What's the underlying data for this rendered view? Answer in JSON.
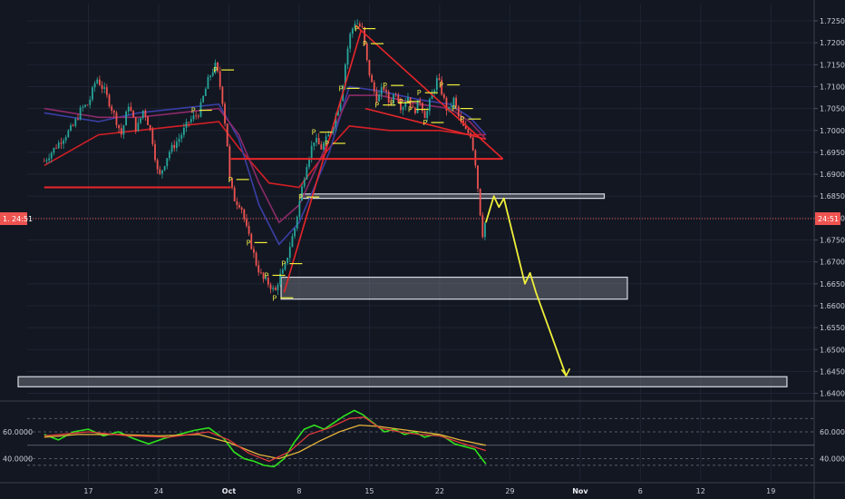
{
  "colors": {
    "background": "#131722",
    "grid": "#1e2433",
    "bull": "#26a69a",
    "bear": "#ef5350",
    "price_line": "#ef5350",
    "trendline": "#e8262a",
    "projection": "#f0f03a",
    "zone_fill": "#9aa0aa",
    "zone_stroke": "#d8dbe2",
    "ma_red": "#d31f26",
    "ma_blue": "#3a3fa6",
    "ma_purple": "#8c2a6a",
    "rsi_green": "#2ee21d",
    "rsi_yellow": "#e6b43a",
    "rsi_red": "#e23b3b"
  },
  "price_tag": {
    "left": "1.",
    "right": "24:51"
  },
  "chart_data": [
    {
      "type": "candlestick",
      "title": "",
      "y_ticks": [
        "1.72500",
        "1.72000",
        "1.71500",
        "1.71000",
        "1.70500",
        "1.70000",
        "1.69500",
        "1.69000",
        "1.68500",
        "1.68000",
        "1.67500",
        "1.67000",
        "1.66500",
        "1.66000",
        "1.65500",
        "1.65000",
        "1.64500",
        "1.64000"
      ],
      "x_ticks": [
        {
          "label": "17",
          "bold": false,
          "day": 17
        },
        {
          "label": "24",
          "bold": false,
          "day": 24
        },
        {
          "label": "Oct",
          "bold": true,
          "day": 31
        },
        {
          "label": "8",
          "bold": false,
          "day": 38
        },
        {
          "label": "15",
          "bold": false,
          "day": 45
        },
        {
          "label": "22",
          "bold": false,
          "day": 52
        },
        {
          "label": "29",
          "bold": false,
          "day": 59
        },
        {
          "label": "Nov",
          "bold": true,
          "day": 66
        },
        {
          "label": "6",
          "bold": false,
          "day": 72
        },
        {
          "label": "12",
          "bold": false,
          "day": 78
        },
        {
          "label": "19",
          "bold": false,
          "day": 85
        }
      ],
      "ylim": [
        1.6375,
        1.7275
      ],
      "current_price": 1.681,
      "pivot_label": "P",
      "price_path": [
        [
          12.6,
          1.693
        ],
        [
          14,
          1.697
        ],
        [
          15.5,
          1.701
        ],
        [
          16.3,
          1.705
        ],
        [
          17,
          1.706
        ],
        [
          17.8,
          1.712
        ],
        [
          18.6,
          1.709
        ],
        [
          19.5,
          1.704
        ],
        [
          20.3,
          1.699
        ],
        [
          21,
          1.706
        ],
        [
          21.8,
          1.7
        ],
        [
          22.5,
          1.705
        ],
        [
          23.3,
          1.699
        ],
        [
          24,
          1.689
        ],
        [
          25,
          1.695
        ],
        [
          26,
          1.698
        ],
        [
          27,
          1.702
        ],
        [
          28,
          1.704
        ],
        [
          29,
          1.712
        ],
        [
          29.7,
          1.715
        ],
        [
          30.3,
          1.708
        ],
        [
          30.8,
          1.698
        ],
        [
          31.1,
          1.688
        ],
        [
          31.6,
          1.684
        ],
        [
          32.2,
          1.683
        ],
        [
          32.7,
          1.678
        ],
        [
          33.2,
          1.674
        ],
        [
          33.8,
          1.669
        ],
        [
          34.4,
          1.666
        ],
        [
          35,
          1.665
        ],
        [
          35.6,
          1.663
        ],
        [
          36,
          1.6665
        ],
        [
          36.5,
          1.668
        ],
        [
          37,
          1.673
        ],
        [
          37.6,
          1.678
        ],
        [
          38.2,
          1.686
        ],
        [
          38.8,
          1.693
        ],
        [
          39.5,
          1.698
        ],
        [
          40.2,
          1.696
        ],
        [
          41,
          1.699
        ],
        [
          41.6,
          1.703
        ],
        [
          42.2,
          1.708
        ],
        [
          42.7,
          1.717
        ],
        [
          43.1,
          1.722
        ],
        [
          43.6,
          1.725
        ],
        [
          44.3,
          1.723
        ],
        [
          44.8,
          1.715
        ],
        [
          45.3,
          1.71
        ],
        [
          45.8,
          1.707
        ],
        [
          46.4,
          1.71
        ],
        [
          47,
          1.706
        ],
        [
          47.6,
          1.709
        ],
        [
          48.2,
          1.705
        ],
        [
          48.8,
          1.708
        ],
        [
          49.4,
          1.704
        ],
        [
          50,
          1.707
        ],
        [
          50.6,
          1.703
        ],
        [
          51.2,
          1.708
        ],
        [
          51.8,
          1.712
        ],
        [
          52.3,
          1.708
        ],
        [
          52.8,
          1.704
        ],
        [
          53.4,
          1.707
        ],
        [
          53.9,
          1.703
        ],
        [
          54.5,
          1.7
        ],
        [
          55.1,
          1.699
        ],
        [
          55.6,
          1.692
        ],
        [
          56,
          1.682
        ],
        [
          56.3,
          1.676
        ],
        [
          56.6,
          1.68
        ]
      ],
      "moving_averages": [
        {
          "color_key": "ma_red",
          "path": [
            [
              12.6,
              1.692
            ],
            [
              18,
              1.699
            ],
            [
              22,
              1.7
            ],
            [
              26,
              1.701
            ],
            [
              30,
              1.702
            ],
            [
              32,
              1.696
            ],
            [
              35,
              1.688
            ],
            [
              38,
              1.687
            ],
            [
              41,
              1.696
            ],
            [
              43,
              1.701
            ],
            [
              47,
              1.7
            ],
            [
              52,
              1.7
            ],
            [
              55,
              1.699
            ],
            [
              56.6,
              1.699
            ]
          ]
        },
        {
          "color_key": "ma_blue",
          "path": [
            [
              12.6,
              1.704
            ],
            [
              18,
              1.702
            ],
            [
              22,
              1.704
            ],
            [
              26,
              1.705
            ],
            [
              30,
              1.706
            ],
            [
              32,
              1.698
            ],
            [
              34,
              1.683
            ],
            [
              36,
              1.674
            ],
            [
              38,
              1.679
            ],
            [
              41,
              1.695
            ],
            [
              43,
              1.71
            ],
            [
              46,
              1.709
            ],
            [
              50,
              1.707
            ],
            [
              53,
              1.706
            ],
            [
              55,
              1.703
            ],
            [
              56.6,
              1.699
            ]
          ]
        },
        {
          "color_key": "ma_purple",
          "path": [
            [
              12.6,
              1.705
            ],
            [
              18,
              1.703
            ],
            [
              22,
              1.703
            ],
            [
              26,
              1.704
            ],
            [
              30,
              1.705
            ],
            [
              32,
              1.699
            ],
            [
              34,
              1.688
            ],
            [
              36,
              1.679
            ],
            [
              38,
              1.683
            ],
            [
              41,
              1.698
            ],
            [
              43,
              1.708
            ],
            [
              46,
              1.708
            ],
            [
              50,
              1.706
            ],
            [
              53,
              1.705
            ],
            [
              55,
              1.702
            ],
            [
              56.6,
              1.698
            ]
          ]
        }
      ],
      "pivot_days": [
        27.5,
        29.7,
        31.2,
        33,
        34.8,
        35.6,
        36.5,
        38.2,
        39.5,
        40.8,
        42.2,
        43.8,
        44.6,
        45.8,
        46.6,
        47.3,
        48.2,
        49.1,
        50,
        50.6,
        52.2,
        53.5,
        54.3
      ],
      "resistance_line": {
        "from": [
          12.6,
          1.687
        ],
        "to": [
          31.2,
          1.687
        ]
      },
      "neckline": {
        "from": [
          31.2,
          1.6935
        ],
        "to": [
          58.3,
          1.6935
        ]
      },
      "triangle": [
        [
          43.6,
          1.724
        ],
        [
          58.3,
          1.6935
        ],
        [
          44.6,
          1.705
        ],
        [
          56.6,
          1.698
        ]
      ],
      "rising_trendline": {
        "from": [
          36.5,
          1.663
        ],
        "to": [
          44.2,
          1.723
        ]
      },
      "zones": [
        {
          "from_day": 38.2,
          "to_day": 68.4,
          "y_top": 1.6855,
          "y_bottom": 1.6845
        },
        {
          "from_day": 36.2,
          "to_day": 70.7,
          "y_top": 1.6665,
          "y_bottom": 1.6615
        },
        {
          "from_day": 10,
          "to_day": 86.6,
          "y_top": 1.6438,
          "y_bottom": 1.6415
        }
      ],
      "projection": [
        [
          56.6,
          1.679
        ],
        [
          57.4,
          1.685
        ],
        [
          57.9,
          1.6825
        ],
        [
          58.4,
          1.6845
        ],
        [
          60.5,
          1.665
        ],
        [
          61,
          1.6675
        ],
        [
          61.6,
          1.663
        ],
        [
          64.6,
          1.644
        ]
      ]
    },
    {
      "type": "line",
      "title": "",
      "y_ticks": [
        "60.0000",
        "40.0000"
      ],
      "ylim": [
        32,
        82
      ],
      "levels": [
        70,
        60,
        50,
        40,
        35
      ],
      "series": [
        {
          "color_key": "rsi_green",
          "values": [
            [
              12.6,
              58
            ],
            [
              14,
              54
            ],
            [
              15.5,
              60
            ],
            [
              17,
              62
            ],
            [
              18.5,
              57
            ],
            [
              20,
              60
            ],
            [
              21.5,
              55
            ],
            [
              23,
              51
            ],
            [
              24.5,
              55
            ],
            [
              26,
              58
            ],
            [
              27.5,
              61
            ],
            [
              29,
              63
            ],
            [
              30.5,
              55
            ],
            [
              31.5,
              45
            ],
            [
              32.5,
              40
            ],
            [
              33.5,
              38
            ],
            [
              34.5,
              35
            ],
            [
              35.5,
              34
            ],
            [
              36.5,
              40
            ],
            [
              37.5,
              52
            ],
            [
              38.5,
              62
            ],
            [
              39.5,
              65
            ],
            [
              40.5,
              62
            ],
            [
              41.5,
              67
            ],
            [
              42.5,
              72
            ],
            [
              43.5,
              76
            ],
            [
              44.3,
              73
            ],
            [
              45.5,
              66
            ],
            [
              46.5,
              60
            ],
            [
              47.5,
              62
            ],
            [
              48.5,
              58
            ],
            [
              49.5,
              60
            ],
            [
              50.5,
              56
            ],
            [
              51.5,
              58
            ],
            [
              52.5,
              56
            ],
            [
              53.5,
              51
            ],
            [
              54.5,
              49
            ],
            [
              55.5,
              47
            ],
            [
              56,
              42
            ],
            [
              56.6,
              36
            ]
          ]
        },
        {
          "color_key": "rsi_yellow",
          "values": [
            [
              12.6,
              56
            ],
            [
              16,
              58
            ],
            [
              20,
              58
            ],
            [
              24,
              57
            ],
            [
              28,
              58
            ],
            [
              31,
              52
            ],
            [
              34,
              43
            ],
            [
              36,
              40
            ],
            [
              38,
              45
            ],
            [
              40,
              53
            ],
            [
              42,
              60
            ],
            [
              44,
              65
            ],
            [
              46,
              64
            ],
            [
              48,
              62
            ],
            [
              50,
              60
            ],
            [
              52,
              58
            ],
            [
              54,
              54
            ],
            [
              56.6,
              50
            ]
          ]
        },
        {
          "color_key": "rsi_red",
          "values": [
            [
              12.6,
              57
            ],
            [
              17,
              60
            ],
            [
              21,
              57
            ],
            [
              25,
              56
            ],
            [
              29,
              60
            ],
            [
              31,
              54
            ],
            [
              33,
              44
            ],
            [
              35,
              38
            ],
            [
              37,
              45
            ],
            [
              39,
              58
            ],
            [
              41,
              63
            ],
            [
              43,
              70
            ],
            [
              44.5,
              71
            ],
            [
              46,
              63
            ],
            [
              48,
              60
            ],
            [
              50,
              58
            ],
            [
              52,
              57
            ],
            [
              54,
              52
            ],
            [
              56.6,
              46
            ]
          ]
        }
      ]
    }
  ]
}
